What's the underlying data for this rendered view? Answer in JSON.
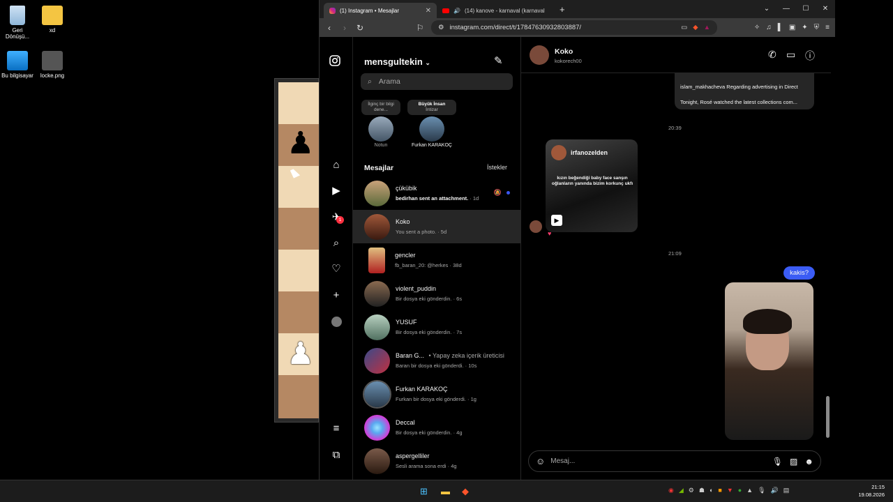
{
  "desktop": {
    "icons": [
      {
        "label": "Geri Dönüşü...",
        "icon": "recycle-bin-icon"
      },
      {
        "label": "xd",
        "icon": "folder-icon"
      },
      {
        "label": "Bu bilgisayar",
        "icon": "computer-icon"
      },
      {
        "label": "locke.png",
        "icon": "image-file-icon"
      }
    ]
  },
  "browser": {
    "tabs": [
      {
        "title": "(1) Instagram • Mesajlar"
      },
      {
        "title": "(14) kanove - karnaval (karnaval"
      }
    ],
    "url": "instagram.com/direct/t/17847630932803887/"
  },
  "instagram": {
    "username": "mensgultekin",
    "search_placeholder": "Arama",
    "notes": [
      {
        "bubble": "İlginç bir bilgi dene...",
        "label": "Notun"
      },
      {
        "bubble_title": "Büyük İnsan",
        "bubble_sub": "İntizar",
        "label": "Furkan KARAKOÇ"
      }
    ],
    "section_title": "Mesajlar",
    "requests_label": "İstekler",
    "notification_count": "1",
    "conversations": [
      {
        "name": "çükübik",
        "preview": "bedirhan sent an attachment.",
        "time": "· 1d",
        "unread": true,
        "muted": true
      },
      {
        "name": "Koko",
        "preview": "You sent a photo.",
        "time": "· 5d",
        "selected": true
      },
      {
        "name": "gencler",
        "preview": "fb_baran_20: @herkes",
        "time": "· 38d"
      },
      {
        "name": "violent_puddin",
        "preview": "Bir dosya eki gönderdin.",
        "time": "· 6s"
      },
      {
        "name": "YUSUF",
        "preview": "Bir dosya eki gönderdin.",
        "time": "· 7s"
      },
      {
        "name": "Baran G...",
        "badge": "• Yapay zeka içerik üreticisi",
        "preview": "Baran bir dosya eki gönderdi.",
        "time": "· 10s"
      },
      {
        "name": "Furkan KARAKOÇ",
        "preview": "Furkan bir dosya eki gönderdi.",
        "time": "· 1g"
      },
      {
        "name": "Deccal",
        "preview": "Bir dosya eki gönderdin.",
        "time": "· 4g"
      },
      {
        "name": "aspergelliler",
        "preview": "Sesli arama sona erdi",
        "time": "· 4g"
      }
    ],
    "chat": {
      "name": "Koko",
      "handle": "kokorech00",
      "reel_card_lines": [
        "islam_makhacheva Regarding advertising in Direct",
        "Tonight, Rosé watched the latest collections com..."
      ],
      "time1": "20:39",
      "reel_user": "irfanozelden",
      "reel_text": "kızın beğendiği baby face sanşın oğlanların yanında bizim korkunç ukfı",
      "time2": "21:09",
      "my_message": "kakis?",
      "composer_placeholder": "Mesaj..."
    }
  },
  "taskbar": {
    "time": "21:15",
    "date": "19.08.2026"
  }
}
